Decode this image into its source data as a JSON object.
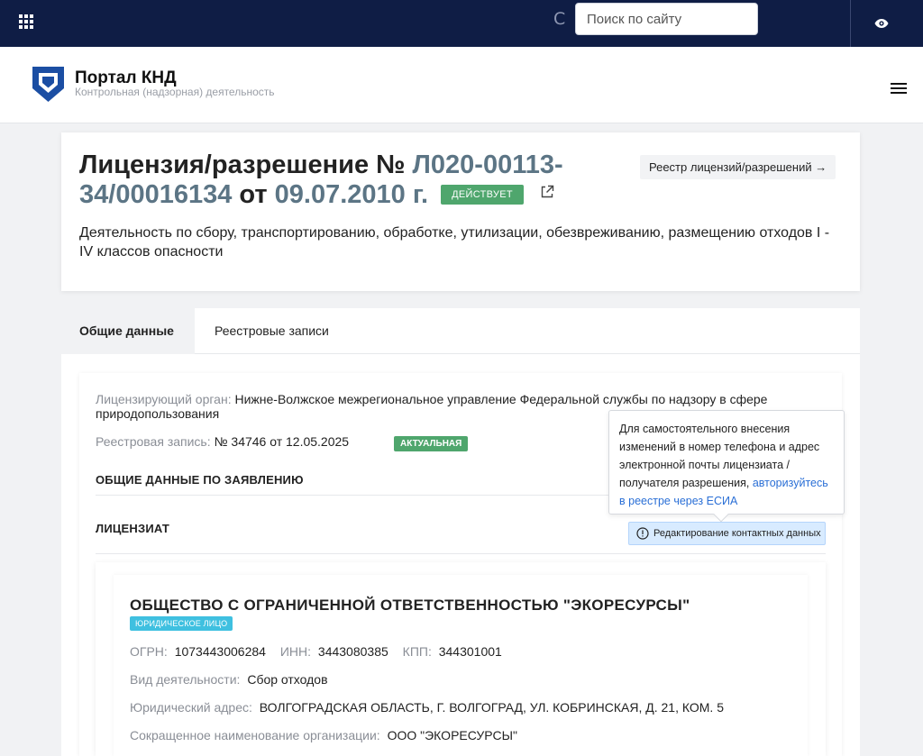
{
  "topbar": {
    "search_placeholder": "Поиск по сайту",
    "spinner_glyph": "C"
  },
  "header": {
    "title": "Портал КНД",
    "subtitle": "Контрольная (надзорная) деятельность"
  },
  "license": {
    "title_prefix": "Лицензия/разрешение № ",
    "number": "Л020-00113-34/00016134",
    "from_word": " от ",
    "date": "09.07.2010 г.",
    "status": "ДЕЙСТВУЕТ",
    "registry_link": "Реестр лицензий/разрешений →",
    "description": "Деятельность по сбору, транспортированию, обработке, утилизации, обезвреживанию, размещению отходов I - IV классов опасности"
  },
  "tabs": [
    {
      "label": "Общие данные",
      "active": true
    },
    {
      "label": "Реестровые записи",
      "active": false
    }
  ],
  "info": {
    "licensing_body_label": "Лицензирующий орган:",
    "licensing_body_value": "Нижне-Волжское межрегиональное управление Федеральной службы по надзору в сфере природопользования",
    "registry_record_label": "Реестровая запись:",
    "registry_record_value": "№ 34746 от 12.05.2025",
    "registry_status": "АКТУАЛЬНАЯ",
    "section_application": "ОБЩИЕ ДАННЫЕ ПО ЗАЯВЛЕНИЮ",
    "section_licensee": "ЛИЦЕНЗИАТ"
  },
  "tooltip": {
    "text": "Для самостоятельного внесения изменений в номер телефона и адрес электронной почты лицензиата / получателя разрешения,",
    "link": "авторизуйтесь в реестре через ЕСИА"
  },
  "edit_contacts_button": "Редактирование контактных данных",
  "licensee": {
    "name": "ОБЩЕСТВО С ОГРАНИЧЕННОЙ ОТВЕТСТВЕННОСТЬЮ \"ЭКОРЕСУРСЫ\"",
    "type": "ЮРИДИЧЕСКОЕ ЛИЦО",
    "ogrn_label": "ОГРН:",
    "ogrn": "1073443006284",
    "inn_label": "ИНН:",
    "inn": "3443080385",
    "kpp_label": "КПП:",
    "kpp": "344301001",
    "activity_label": "Вид деятельности:",
    "activity": "Сбор отходов",
    "address_label": "Юридический адрес:",
    "address": "ВОЛГОГРАДСКАЯ ОБЛАСТЬ, Г. ВОЛГОГРАД, УЛ. КОБРИНСКАЯ, Д. 21, КОМ. 5",
    "short_name_label": "Сокращенное наименование организации:",
    "short_name": "ООО \"ЭКОРЕСУРСЫ\""
  },
  "colors": {
    "topbar": "#0f1d45",
    "accent_number": "#5c7585",
    "status_green": "#4fa66d",
    "badge_cyan": "#3fc0e0",
    "link_blue": "#2a6fd6"
  }
}
